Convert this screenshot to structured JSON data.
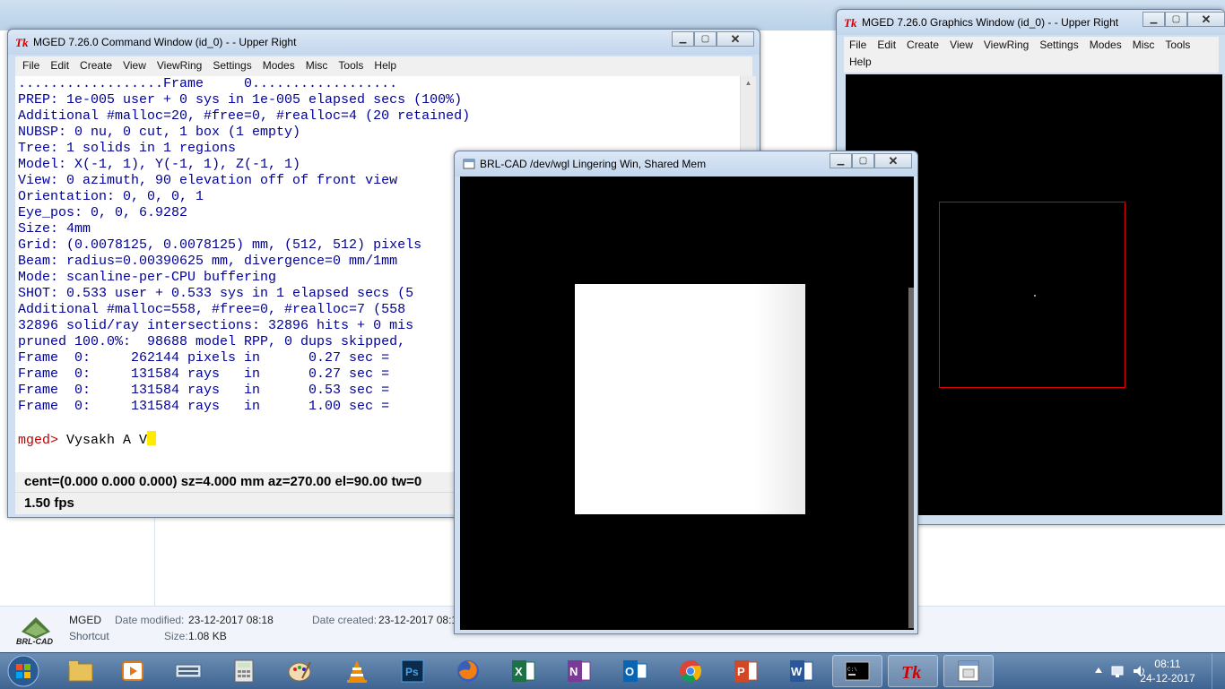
{
  "command_window": {
    "title": "MGED 7.26.0 Command Window (id_0) -  - Upper Right",
    "menu": [
      "File",
      "Edit",
      "Create",
      "View",
      "ViewRing",
      "Settings",
      "Modes",
      "Misc",
      "Tools",
      "Help"
    ],
    "console_lines": [
      "..................Frame     0..................",
      "PREP: 1e-005 user + 0 sys in 1e-005 elapsed secs (100%)",
      "Additional #malloc=20, #free=0, #realloc=4 (20 retained)",
      "NUBSP: 0 nu, 0 cut, 1 box (1 empty)",
      "Tree: 1 solids in 1 regions",
      "Model: X(-1, 1), Y(-1, 1), Z(-1, 1)",
      "View: 0 azimuth, 90 elevation off of front view",
      "Orientation: 0, 0, 0, 1",
      "Eye_pos: 0, 0, 6.9282",
      "Size: 4mm",
      "Grid: (0.0078125, 0.0078125) mm, (512, 512) pixels",
      "Beam: radius=0.00390625 mm, divergence=0 mm/1mm",
      "Mode: scanline-per-CPU buffering",
      "",
      "SHOT: 0.533 user + 0.533 sys in 1 elapsed secs (5",
      "Additional #malloc=558, #free=0, #realloc=7 (558",
      "32896 solid/ray intersections: 32896 hits + 0 mis",
      "pruned 100.0%:  98688 model RPP, 0 dups skipped,",
      "Frame  0:     262144 pixels in      0.27 sec =",
      "Frame  0:     131584 rays   in      0.27 sec =",
      "Frame  0:     131584 rays   in      0.53 sec =",
      "Frame  0:     131584 rays   in      1.00 sec =",
      ""
    ],
    "prompt": "mged>",
    "command_input": "Vysakh A V",
    "status_line": "cent=(0.000 0.000 0.000) sz=4.000  mm  az=270.00  el=90.00  tw=0",
    "fps": "1.50 fps"
  },
  "graphics_window": {
    "title": "MGED 7.26.0 Graphics Window (id_0) -  - Upper Right",
    "menu": [
      "File",
      "Edit",
      "Create",
      "View",
      "ViewRing",
      "Settings",
      "Modes",
      "Misc",
      "Tools",
      "Help"
    ]
  },
  "framebuffer_window": {
    "title": "BRL-CAD /dev/wgl Lingering Win, Shared Mem"
  },
  "details_pane": {
    "name": "MGED",
    "type": "Shortcut",
    "date_modified_label": "Date modified:",
    "date_modified": "23-12-2017 08:18",
    "size_label": "Size:",
    "size": "1.08 KB",
    "date_created_label": "Date created:",
    "date_created": "23-12-2017 08:1",
    "logo_text": "BRL-CAD"
  },
  "taskbar": {
    "apps": [
      "file-explorer",
      "media-player",
      "on-screen-keyboard",
      "calculator",
      "paint",
      "vlc",
      "photoshop",
      "firefox",
      "excel",
      "onenote",
      "outlook",
      "chrome",
      "powerpoint",
      "word",
      "command-prompt",
      "tk-mged",
      "brlcad-viewer"
    ],
    "time": "08:11",
    "date": "24-12-2017"
  },
  "colors": {
    "console_text": "#000099",
    "prompt": "#c00000",
    "cursor": "#ffea00",
    "graphics_bounding_box": "#e00000"
  }
}
